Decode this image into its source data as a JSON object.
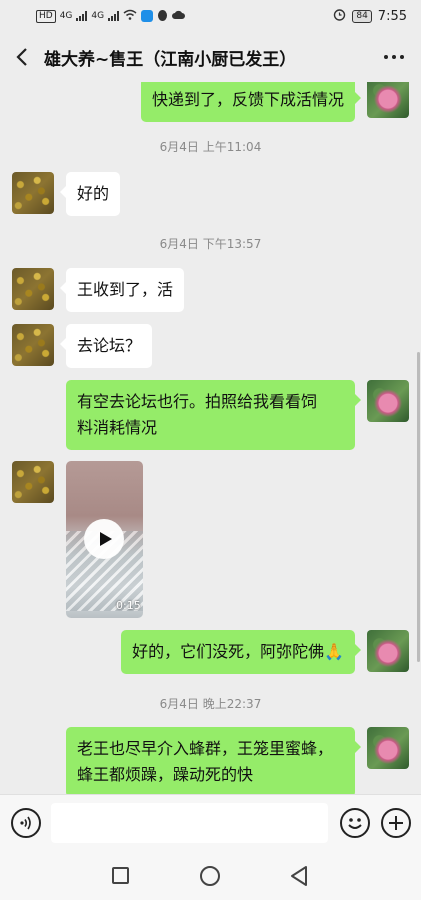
{
  "status_bar": {
    "left_badge": "HD",
    "net1": "4G",
    "net2": "4G",
    "battery": "84",
    "time": "7:55"
  },
  "header": {
    "title": "雄大养~售王（江南小厨已发王）"
  },
  "messages": [
    {
      "side": "right",
      "type": "text",
      "text": "快递到了，反馈下成活情况"
    },
    {
      "type": "time",
      "text": "6月4日 上午11:04"
    },
    {
      "side": "left",
      "type": "text",
      "text": "好的"
    },
    {
      "type": "time",
      "text": "6月4日 下午13:57"
    },
    {
      "side": "left",
      "type": "text",
      "text": "王收到了，活"
    },
    {
      "side": "left",
      "type": "text",
      "text": "去论坛？"
    },
    {
      "side": "right",
      "type": "text",
      "line1": "有空去论坛也行。拍照给我看看饲",
      "line2": "料消耗情况"
    },
    {
      "side": "left",
      "type": "video",
      "duration": "0:15"
    },
    {
      "side": "right",
      "type": "text",
      "text": "好的，它们没死，阿弥陀佛🙏"
    },
    {
      "type": "time",
      "text": "6月4日 晚上22:37"
    },
    {
      "side": "right",
      "type": "text",
      "line1": "老王也尽早介入蜂群，王笼里蜜蜂，",
      "line2": "蜂王都烦躁，躁动死的快"
    }
  ],
  "input": {
    "placeholder": ""
  }
}
